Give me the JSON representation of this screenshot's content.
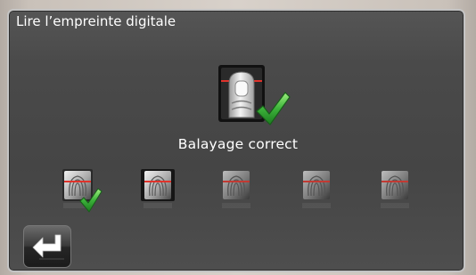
{
  "window": {
    "title": "Lire l’empreinte digitale"
  },
  "scan": {
    "status_text": "Balayage correct",
    "main_icon": "finger-sensor-icon",
    "check_icon": "checkmark-icon"
  },
  "steps": [
    {
      "icon": "fingerprint-icon",
      "state": "done"
    },
    {
      "icon": "fingerprint-icon",
      "state": "active"
    },
    {
      "icon": "fingerprint-icon",
      "state": "pending"
    },
    {
      "icon": "fingerprint-icon",
      "state": "pending"
    },
    {
      "icon": "fingerprint-icon",
      "state": "pending"
    }
  ],
  "footer": {
    "back_icon": "return-arrow-icon"
  },
  "colors": {
    "panel": "#4a4a4a",
    "border": "#c4c4c4",
    "scan_line": "#e0332b",
    "check": "#3cb23a",
    "text": "#ffffff"
  }
}
